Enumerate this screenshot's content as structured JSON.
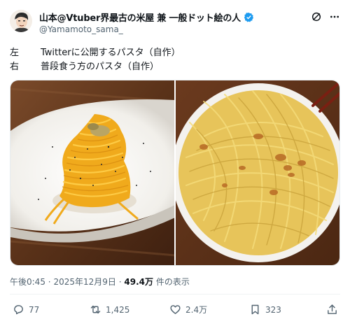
{
  "author": {
    "display_name": "山本@Vtuber界最古の米屋 兼 一般ドット絵の人",
    "handle": "@Yamamoto_sama_"
  },
  "tweet": {
    "lines": [
      {
        "side": "左",
        "text": "Twitterに公開するパスタ（自作）"
      },
      {
        "side": "右",
        "text": "普段食う方のパスタ（自作）"
      }
    ]
  },
  "meta": {
    "time": "午後0:45",
    "sep1": "·",
    "date": "2025年12月9日",
    "sep2": "·",
    "views": "49.4万",
    "views_suffix": "件の表示"
  },
  "actions": {
    "replies": "77",
    "reposts": "1,425",
    "likes": "2.4万",
    "bookmarks": "323"
  },
  "colors": {
    "verified": "#1d9bf0",
    "secondary_text": "#536471",
    "pasta_left": "#f2b324",
    "pasta_right": "#e7c45a"
  }
}
